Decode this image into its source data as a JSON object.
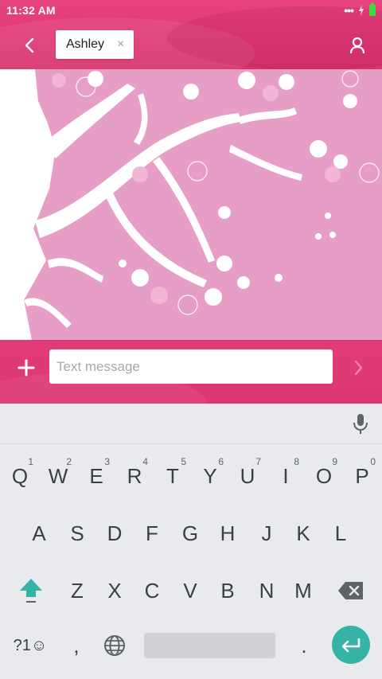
{
  "status_bar": {
    "time": "11:32 AM"
  },
  "conversation": {
    "recipient_chip": "Ashley",
    "chip_close": "×"
  },
  "composer": {
    "placeholder": "Text message"
  },
  "keyboard": {
    "row1": [
      {
        "label": "Q",
        "hint": "1"
      },
      {
        "label": "W",
        "hint": "2"
      },
      {
        "label": "E",
        "hint": "3"
      },
      {
        "label": "R",
        "hint": "4"
      },
      {
        "label": "T",
        "hint": "5"
      },
      {
        "label": "Y",
        "hint": "6"
      },
      {
        "label": "U",
        "hint": "7"
      },
      {
        "label": "I",
        "hint": "8"
      },
      {
        "label": "O",
        "hint": "9"
      },
      {
        "label": "P",
        "hint": "0"
      }
    ],
    "row2": [
      "A",
      "S",
      "D",
      "F",
      "G",
      "H",
      "J",
      "K",
      "L"
    ],
    "row3": [
      "Z",
      "X",
      "C",
      "V",
      "B",
      "N",
      "M"
    ],
    "symbols_label": "?1☺",
    "comma": ",",
    "period": "."
  },
  "colors": {
    "app_bar": "#e23c78",
    "wallpaper": "#e69ec7",
    "blossom": "#ffffff",
    "keyboard_bg": "#e8eaed",
    "accent_teal": "#35b3a6"
  },
  "icons": {
    "back": "chevron-left-icon",
    "profile": "person-icon",
    "add": "plus-icon",
    "send": "chevron-right-icon",
    "mic": "microphone-icon",
    "shift": "shift-arrow-icon",
    "backspace": "backspace-icon",
    "language": "globe-icon",
    "enter": "enter-arrow-icon"
  }
}
